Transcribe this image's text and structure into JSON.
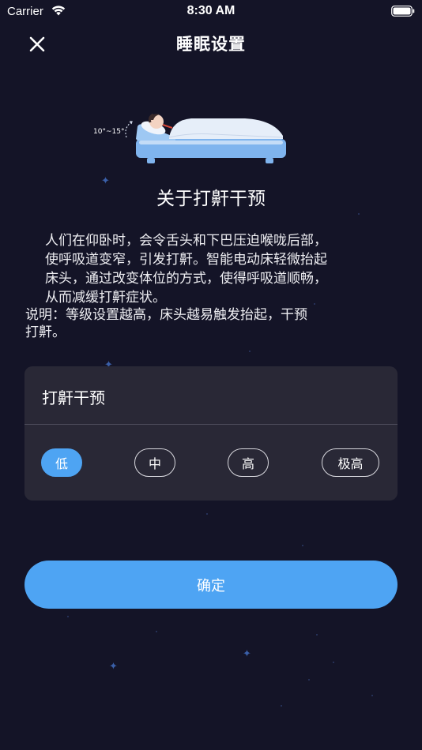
{
  "status_bar": {
    "carrier": "Carrier",
    "time": "8:30 AM"
  },
  "nav": {
    "title": "睡眠设置",
    "close_icon": "close-icon"
  },
  "illustration": {
    "angle_label": "10°~15°"
  },
  "section": {
    "title": "关于打鼾干预",
    "description_lines": [
      "人们在仰卧时，会令舌头和下巴压迫喉咙后部，",
      "使呼吸道变窄，引发打鼾。智能电动床轻微抬起",
      "床头，通过改变体位的方式，使得呼吸道顺畅，",
      "从而减缓打鼾症状。"
    ],
    "note_lines": [
      "说明：等级设置越高，床头越易触发抬起，干预",
      "打鼾。"
    ]
  },
  "card": {
    "title": "打鼾干预",
    "levels": [
      "低",
      "中",
      "高",
      "极高"
    ],
    "selected_level": "低"
  },
  "confirm_label": "确定",
  "colors": {
    "background": "#141427",
    "card": "#292836",
    "accent": "#4ea4f3"
  }
}
